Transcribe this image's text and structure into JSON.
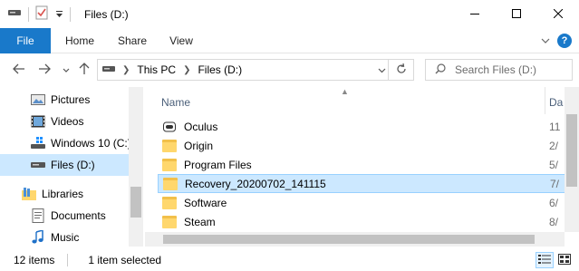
{
  "window": {
    "title": "Files (D:)",
    "minimize_icon": "minimize-icon",
    "maximize_icon": "maximize-icon",
    "close_icon": "close-icon"
  },
  "ribbon": {
    "tabs": [
      {
        "label": "File"
      },
      {
        "label": "Home"
      },
      {
        "label": "Share"
      },
      {
        "label": "View"
      }
    ],
    "help": "?"
  },
  "address": {
    "crumbs": [
      "This PC",
      "Files (D:)"
    ],
    "search_placeholder": "Search Files (D:)"
  },
  "nav": {
    "items": [
      {
        "label": "Pictures",
        "icon": "pictures-icon"
      },
      {
        "label": "Videos",
        "icon": "videos-icon"
      },
      {
        "label": "Windows 10 (C:)",
        "icon": "drive-icon"
      },
      {
        "label": "Files (D:)",
        "icon": "drive-icon",
        "selected": true
      },
      {
        "label": "Libraries",
        "icon": "libraries-icon"
      },
      {
        "label": "Documents",
        "icon": "documents-icon"
      },
      {
        "label": "Music",
        "icon": "music-icon"
      }
    ]
  },
  "files": {
    "columns": {
      "name": "Name",
      "date": "Da"
    },
    "rows": [
      {
        "name": "Oculus",
        "date": "11",
        "icon": "oculus-folder-icon"
      },
      {
        "name": "Origin",
        "date": "2/",
        "icon": "folder-icon"
      },
      {
        "name": "Program Files",
        "date": "5/",
        "icon": "folder-icon"
      },
      {
        "name": "Recovery_20200702_141115",
        "date": "7/",
        "icon": "folder-icon",
        "selected": true
      },
      {
        "name": "Software",
        "date": "6/",
        "icon": "folder-icon"
      },
      {
        "name": "Steam",
        "date": "8/",
        "icon": "folder-icon"
      }
    ]
  },
  "status": {
    "item_count": "12 items",
    "selected": "1 item selected"
  },
  "colors": {
    "accent": "#1979ca",
    "selection": "#cce8ff",
    "folder": "#ffd76d"
  }
}
